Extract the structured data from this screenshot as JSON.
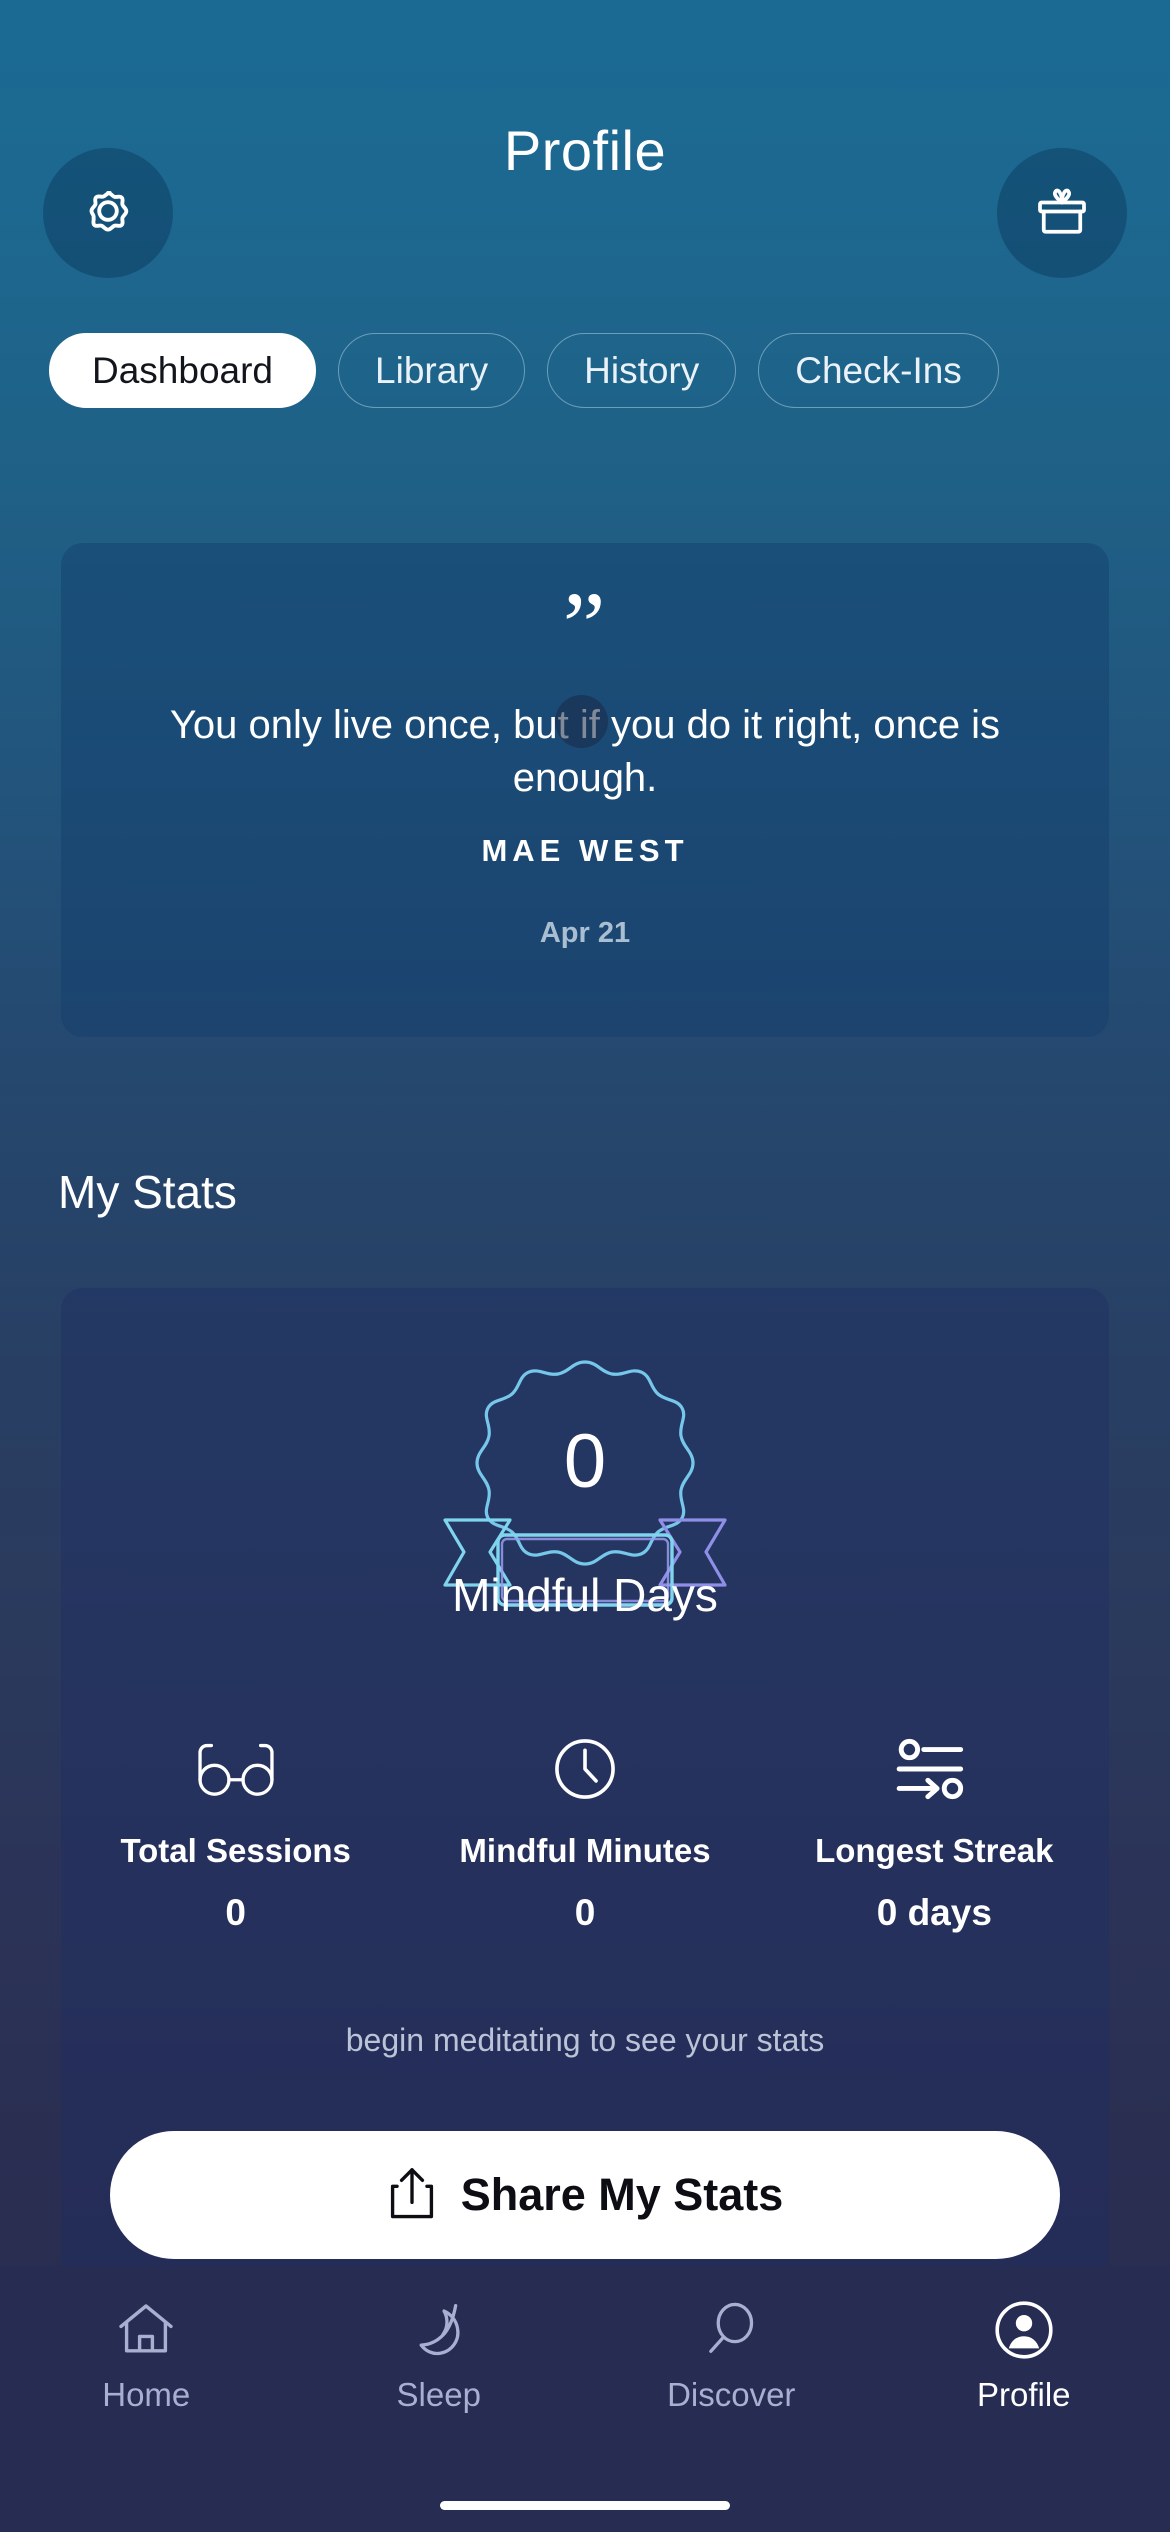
{
  "header": {
    "title": "Profile",
    "settings_icon": "gear-icon",
    "gift_icon": "gift-icon"
  },
  "tabs": [
    {
      "label": "Dashboard",
      "active": true
    },
    {
      "label": "Library",
      "active": false
    },
    {
      "label": "History",
      "active": false
    },
    {
      "label": "Check-Ins",
      "active": false
    }
  ],
  "quote_card": {
    "quote_mark": "”",
    "text": "You only live once, but if you do it right, once is enough.",
    "author": "MAE WEST",
    "date": "Apr 21"
  },
  "stats_section": {
    "title": "My Stats",
    "badge": {
      "value": "0",
      "label": "Mindful Days"
    },
    "stats": [
      {
        "icon": "glasses-icon",
        "label": "Total Sessions",
        "value": "0"
      },
      {
        "icon": "clock-icon",
        "label": "Mindful Minutes",
        "value": "0"
      },
      {
        "icon": "streak-icon",
        "label": "Longest Streak",
        "value": "0 days"
      }
    ],
    "hint": "begin meditating to see your stats",
    "share_button": {
      "label": "Share My Stats",
      "icon": "share-icon"
    }
  },
  "bottom_nav": [
    {
      "label": "Home",
      "icon": "home-icon",
      "active": false
    },
    {
      "label": "Sleep",
      "icon": "moon-icon",
      "active": false
    },
    {
      "label": "Discover",
      "icon": "search-icon",
      "active": false
    },
    {
      "label": "Profile",
      "icon": "person-circle-icon",
      "active": true
    }
  ],
  "colors": {
    "badge_stroke": "#76c7ea",
    "ribbon_stroke_right": "#8f8fe8",
    "nav_bar_bg": "#262c52",
    "accent_white": "#ffffff"
  }
}
